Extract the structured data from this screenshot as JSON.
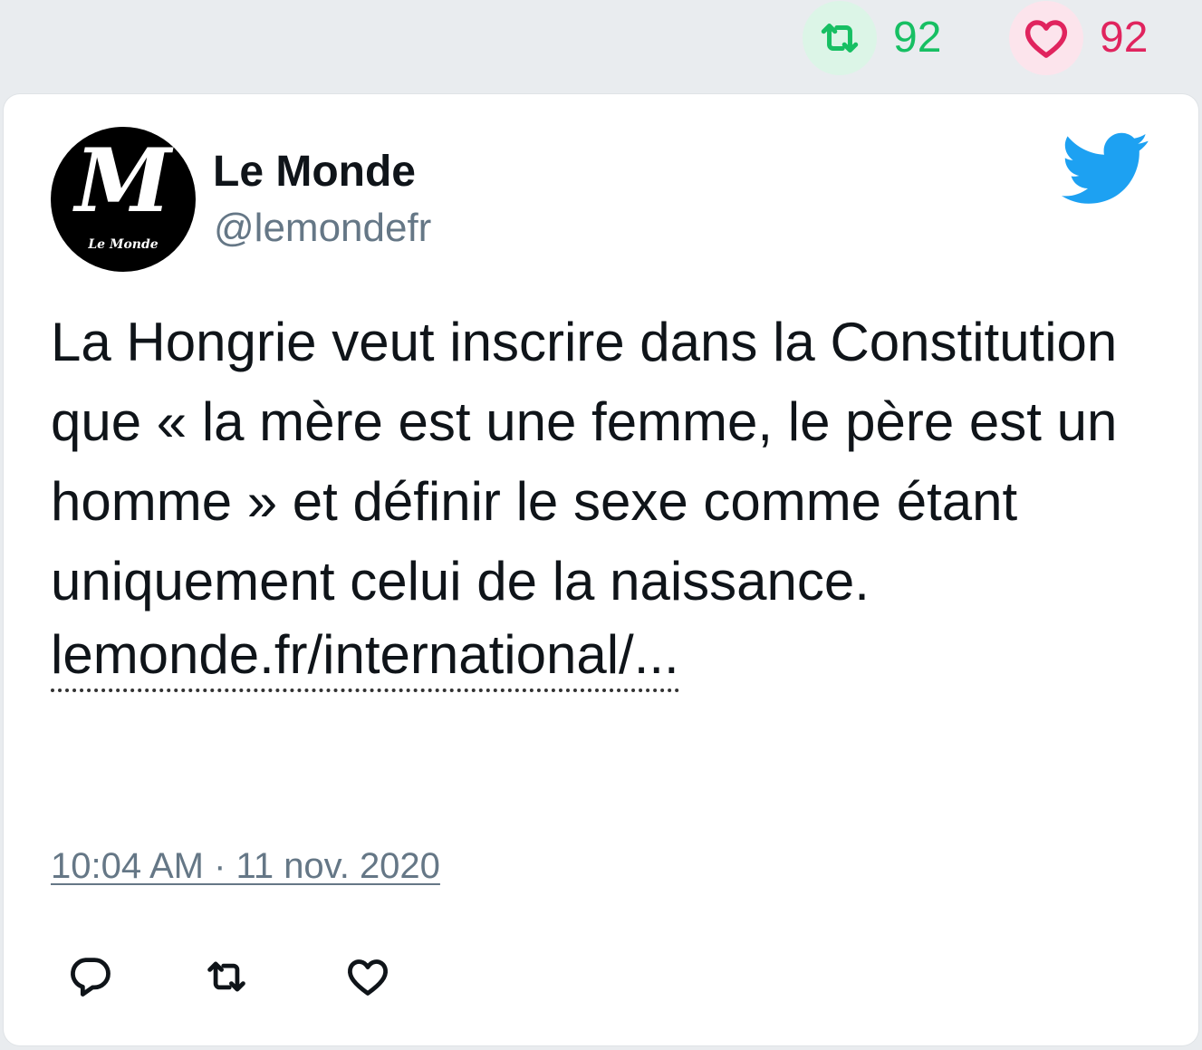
{
  "stats": {
    "retweet_count": "92",
    "like_count": "92",
    "retweet_color": "#17bf63",
    "like_color": "#e0245e"
  },
  "author": {
    "name": "Le Monde",
    "handle": "@lemondefr",
    "avatar_logo": "M",
    "avatar_caption": "Le Monde"
  },
  "tweet": {
    "text": "La Hongrie veut inscrire dans la Constitution que « la mère est une femme, le père est un homme » et définir le sexe comme étant uniquement celui de la naissance.",
    "link": "lemonde.fr/international/...",
    "timestamp": "10:04 AM · 11 nov. 2020"
  },
  "actions": [
    "reply-icon",
    "retweet-icon",
    "heart-icon"
  ],
  "brand": {
    "twitter_blue": "#1da1f2",
    "icon": "twitter-bird-icon"
  }
}
